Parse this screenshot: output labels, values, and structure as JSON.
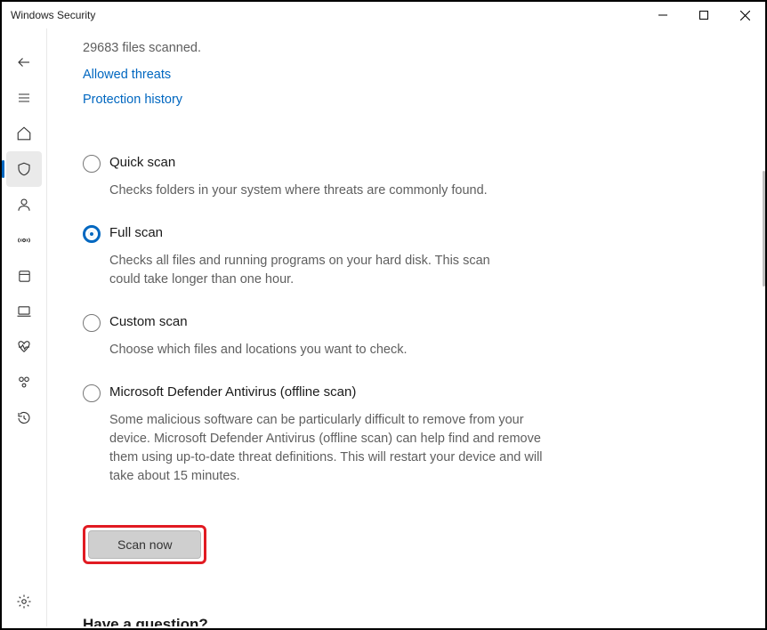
{
  "window": {
    "title": "Windows Security"
  },
  "status": {
    "files_scanned": "29683 files scanned."
  },
  "links": {
    "allowed_threats": "Allowed threats",
    "protection_history": "Protection history"
  },
  "options": {
    "quick": {
      "label": "Quick scan",
      "desc": "Checks folders in your system where threats are commonly found.",
      "selected": false
    },
    "full": {
      "label": "Full scan",
      "desc": "Checks all files and running programs on your hard disk. This scan could take longer than one hour.",
      "selected": true
    },
    "custom": {
      "label": "Custom scan",
      "desc": "Choose which files and locations you want to check.",
      "selected": false
    },
    "offline": {
      "label": "Microsoft Defender Antivirus (offline scan)",
      "desc": "Some malicious software can be particularly difficult to remove from your device. Microsoft Defender Antivirus (offline scan) can help find and remove them using up-to-date threat definitions. This will restart your device and will take about 15 minutes.",
      "selected": false
    }
  },
  "buttons": {
    "scan_now": "Scan now"
  },
  "footer": {
    "question": "Have a question?"
  }
}
